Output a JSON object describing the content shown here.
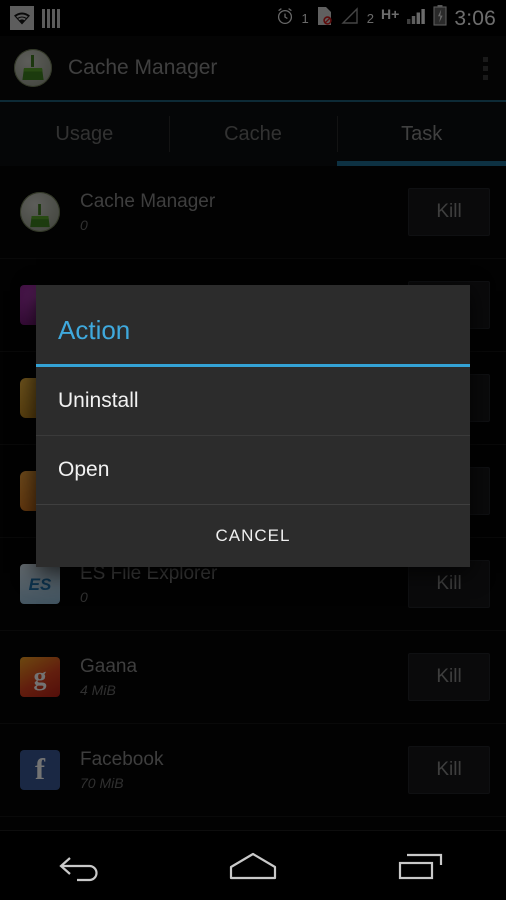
{
  "statusbar": {
    "left_icons": [
      "wifi-icon",
      "signal-bars-icon"
    ],
    "alarm_icon": "alarm-clock-icon",
    "sim1_label": "1",
    "sim1_icon": "sim-no-signal-icon",
    "sim1_signal_icon": "signal-empty-icon",
    "sim2_label": "2",
    "network_type": "H+",
    "sim2_signal_icon": "signal-bars-icon",
    "battery_icon": "battery-charging-icon",
    "time": "3:06"
  },
  "actionbar": {
    "app_icon": "cache-manager-broom-icon",
    "title": "Cache Manager",
    "overflow_icon": "overflow-menu-icon"
  },
  "tabs": [
    {
      "label": "Usage",
      "selected": false
    },
    {
      "label": "Cache",
      "selected": false
    },
    {
      "label": "Task",
      "selected": true
    }
  ],
  "list": {
    "kill_label": "Kill",
    "rows": [
      {
        "name": "Cache Manager",
        "size": "0",
        "icon": "cache-manager-icon",
        "icon_class": "ic ic-cache"
      },
      {
        "name": "",
        "size": "",
        "icon": "app-icon-purple",
        "icon_class": "ic ic-purple"
      },
      {
        "name": "",
        "size": "",
        "icon": "app-icon-gold",
        "icon_class": "ic ic-gold"
      },
      {
        "name": "",
        "size": "",
        "icon": "app-icon-orange",
        "icon_class": "ic ic-orange"
      },
      {
        "name": "ES File Explorer",
        "size": "0",
        "icon": "es-file-explorer-icon",
        "icon_class": "ic ic-es",
        "icon_text": "ES"
      },
      {
        "name": "Gaana",
        "size": "4 MiB",
        "icon": "gaana-icon",
        "icon_class": "ic ic-gaana",
        "icon_text": "g"
      },
      {
        "name": "Facebook",
        "size": "70 MiB",
        "icon": "facebook-icon",
        "icon_class": "ic ic-fb",
        "icon_text": "f"
      }
    ]
  },
  "dialog": {
    "title": "Action",
    "items": [
      "Uninstall",
      "Open"
    ],
    "cancel_label": "CANCEL"
  },
  "navbar": {
    "back_icon": "back-icon",
    "home_icon": "home-icon",
    "recents_icon": "recent-apps-icon"
  },
  "colors": {
    "accent_blue": "#34a3d6",
    "tab_indicator": "#1e6d92",
    "dialog_bg": "#2c2c2c",
    "screen_bg": "#050505"
  }
}
